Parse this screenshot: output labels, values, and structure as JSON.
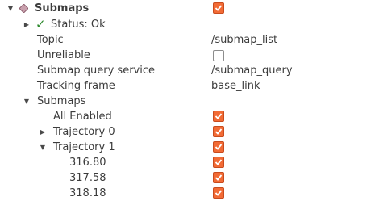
{
  "display": {
    "name": "Submaps",
    "enabled": true,
    "status": {
      "label": "Status: Ok"
    },
    "properties": [
      {
        "label": "Topic",
        "value": "/submap_list",
        "type": "text"
      },
      {
        "label": "Unreliable",
        "checked": false,
        "type": "checkbox"
      },
      {
        "label": "Submap query service",
        "value": "/submap_query",
        "type": "text"
      },
      {
        "label": "Tracking frame",
        "value": "base_link",
        "type": "text"
      }
    ],
    "submaps": {
      "label": "Submaps",
      "all_enabled": {
        "label": "All Enabled",
        "checked": true
      },
      "trajectory0": {
        "label": "Trajectory 0",
        "checked": true
      },
      "trajectory1": {
        "label": "Trajectory 1",
        "checked": true,
        "items": [
          {
            "label": "316.80",
            "checked": true
          },
          {
            "label": "317.58",
            "checked": true
          },
          {
            "label": "318.18",
            "checked": true
          }
        ]
      }
    }
  },
  "colors": {
    "checkbox_checked": "#f26b35",
    "status_ok": "#2f8a2f",
    "plugin_icon": "#b07a8a"
  }
}
